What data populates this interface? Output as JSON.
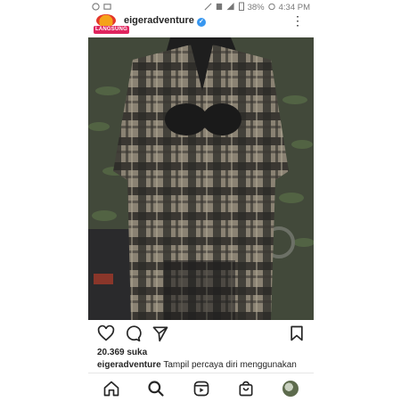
{
  "status_bar": {
    "battery": "38%",
    "time": "4:34 PM"
  },
  "post": {
    "username": "eigeradventure",
    "live_badge": "LANGSUNG",
    "likes": "20.369 suka",
    "caption_user": "eigeradventure",
    "caption_text": "Tampil percaya diri menggunakan"
  },
  "icons": {
    "status_left": [
      "whatsapp-icon",
      "image-icon",
      "message-icon",
      "notification-icon"
    ],
    "actions": [
      "heart-icon",
      "comment-icon",
      "share-icon",
      "bookmark-icon"
    ],
    "nav": [
      "home-icon",
      "search-icon",
      "reels-icon",
      "shop-icon",
      "profile-avatar"
    ]
  },
  "colors": {
    "verified": "#3897f0",
    "live": "#e0245e",
    "text": "#262626"
  }
}
